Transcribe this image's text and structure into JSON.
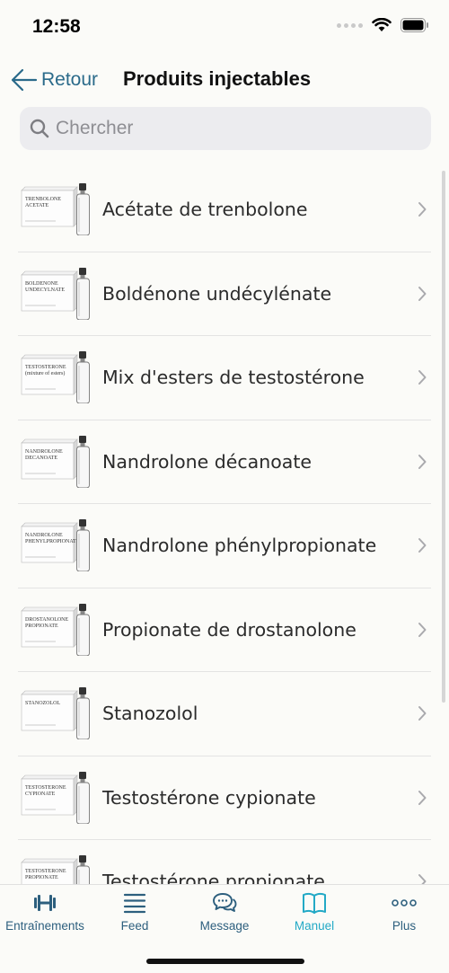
{
  "status": {
    "time": "12:58"
  },
  "nav": {
    "back_label": "Retour",
    "title": "Produits injectables"
  },
  "search": {
    "placeholder": "Chercher"
  },
  "items": [
    {
      "label": "Acétate de trenbolone",
      "box_text": "TRENBOLONE ACETATE"
    },
    {
      "label": "Boldénone undécylénate",
      "box_text": "BOLDENONE UNDECYLNATE"
    },
    {
      "label": "Mix d'esters de testostérone",
      "box_text": "TESTOSTERONE (mixture of esters)"
    },
    {
      "label": "Nandrolone décanoate",
      "box_text": "NANDROLONE DECANOATE"
    },
    {
      "label": "Nandrolone phénylpropionate",
      "box_text": "NANDROLONE PHENYLPROPIONATE"
    },
    {
      "label": "Propionate de drostanolone",
      "box_text": "DROSTANOLONE PROPIONATE"
    },
    {
      "label": "Stanozolol",
      "box_text": "STANOZOLOL"
    },
    {
      "label": "Testostérone cypionate",
      "box_text": "TESTOSTERONE CYPIONATE"
    },
    {
      "label": "Testostérone propionate",
      "box_text": "TESTOSTERONE PROPIONATE"
    }
  ],
  "tabs": [
    {
      "label": "Entraînements",
      "icon": "dumbbell-icon",
      "active": false
    },
    {
      "label": "Feed",
      "icon": "feed-lines-icon",
      "active": false
    },
    {
      "label": "Message",
      "icon": "chat-bubbles-icon",
      "active": false
    },
    {
      "label": "Manuel",
      "icon": "book-icon",
      "active": true
    },
    {
      "label": "Plus",
      "icon": "more-dots-icon",
      "active": false
    }
  ],
  "colors": {
    "accent": "#23a9c6",
    "tab_inactive": "#2d5f7e",
    "back": "#2a6a8a"
  }
}
